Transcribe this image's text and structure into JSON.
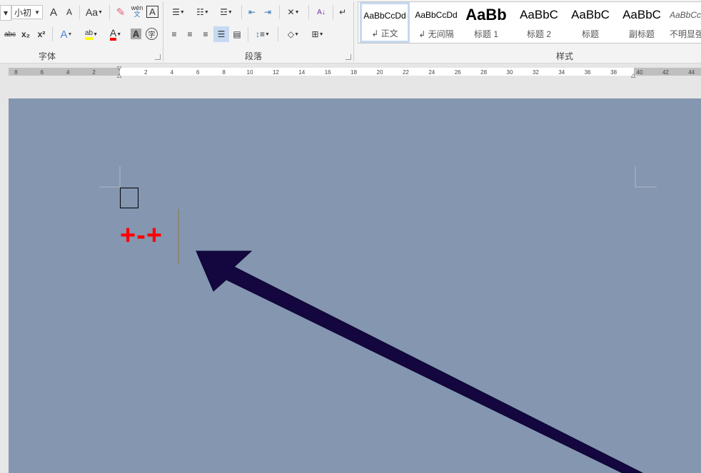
{
  "font": {
    "size_value": "小初",
    "group_label": "字体",
    "buttons": {
      "grow": "A",
      "shrink": "A",
      "change_case": "Aa",
      "phonetic_top": "wén",
      "phonetic_bottom": "文",
      "char_border": "A",
      "strikethrough": "abc",
      "subscript": "x₂",
      "superscript": "x²",
      "text_effect": "A",
      "highlight": "ab",
      "font_color": "A",
      "char_shading": "A",
      "enclose": "字"
    }
  },
  "paragraph": {
    "group_label": "段落",
    "sort": "A↓"
  },
  "styles": {
    "group_label": "样式",
    "items": [
      {
        "sample": "AaBbCcDd",
        "label": "↲ 正文"
      },
      {
        "sample": "AaBbCcDd",
        "label": "↲ 无间隔"
      },
      {
        "sample": "AaBb",
        "label": "标题 1"
      },
      {
        "sample": "AaBbC",
        "label": "标题 2"
      },
      {
        "sample": "AaBbC",
        "label": "标题"
      },
      {
        "sample": "AaBbC",
        "label": "副标题"
      },
      {
        "sample": "AaBbCc",
        "label": "不明显强"
      }
    ]
  },
  "ruler": {
    "left_ticks": [
      "8",
      "6",
      "4",
      "2"
    ],
    "right_ticks": [
      "2",
      "4",
      "6",
      "8",
      "10",
      "12",
      "14",
      "16",
      "18",
      "20",
      "22",
      "24",
      "26",
      "28",
      "30",
      "32",
      "34",
      "36",
      "38",
      "40",
      "42",
      "44"
    ]
  },
  "document": {
    "text": "+-+",
    "colors": {
      "page": "#8496b0",
      "text": "#ff0000",
      "arrow": "#14073f"
    }
  }
}
